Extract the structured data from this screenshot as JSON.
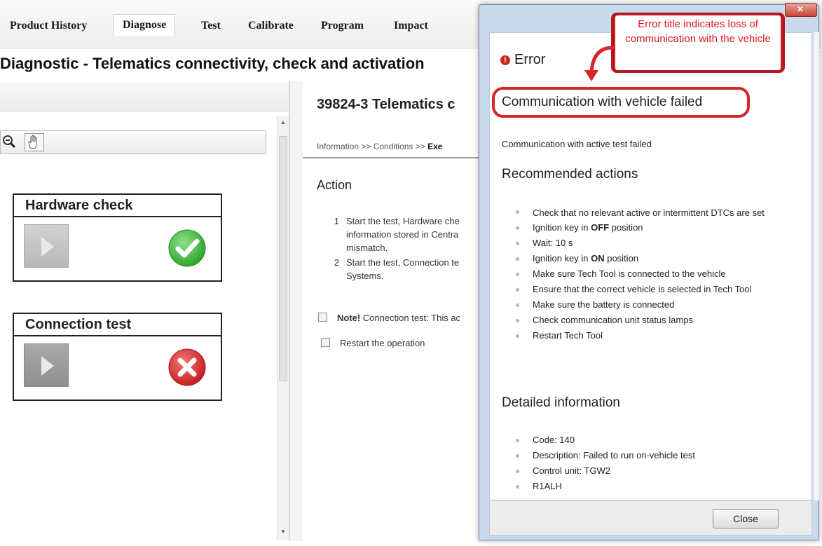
{
  "nav": {
    "tabs": [
      {
        "label": "Product History"
      },
      {
        "label": "Diagnose"
      },
      {
        "label": "Test"
      },
      {
        "label": "Calibrate"
      },
      {
        "label": "Program"
      },
      {
        "label": "Impact"
      }
    ],
    "active_tab": "Diagnose"
  },
  "page": {
    "title": "Diagnostic - Telematics connectivity, check and activation"
  },
  "left": {
    "cards": [
      {
        "title": "Hardware check",
        "status": "check-icon",
        "status_color": "#3db83d"
      },
      {
        "title": "Connection test",
        "status": "error-x-icon",
        "status_color": "#d7262a"
      }
    ]
  },
  "center": {
    "test_title": "39824-3 Telematics c",
    "breadcrumb_prefix": "Information >> Conditions >> ",
    "breadcrumb_current": "Exe",
    "action_heading": "Action",
    "steps": [
      {
        "num": "1",
        "lines": [
          "Start the test, Hardware che",
          "information stored in Centra",
          "mismatch."
        ]
      },
      {
        "num": "2",
        "lines": [
          "Start the test, Connection te",
          "Systems."
        ]
      }
    ],
    "note_bold": "Note!",
    "note_text": " Connection test: This ac",
    "restart_label": "Restart the operation"
  },
  "dialog": {
    "title": "Error",
    "error_heading": "Communication with vehicle failed",
    "error_sub": "Communication with active test failed",
    "recommended_heading": "Recommended actions",
    "recommended": [
      "Check that no relevant active or intermittent DTCs are set",
      "Ignition key in OFF position",
      "Wait: 10 s",
      "Ignition key in ON position",
      "Make sure Tech Tool is connected to the vehicle",
      "Ensure that the correct vehicle is selected in Tech Tool",
      "Make sure the battery is connected",
      "Check communication unit status lamps",
      "Restart Tech Tool"
    ],
    "detailed_heading": "Detailed information",
    "detailed": [
      "Code: 140",
      "Description: Failed to run on-vehicle test",
      "Control unit: TGW2",
      "R1ALH"
    ],
    "close_label": "Close"
  },
  "annotation": {
    "text": "Error title indicates loss of communication with the vehicle",
    "color": "#d6262c"
  },
  "colors": {
    "accent_red": "#d6262c",
    "dialog_frame": "#c9daec"
  }
}
